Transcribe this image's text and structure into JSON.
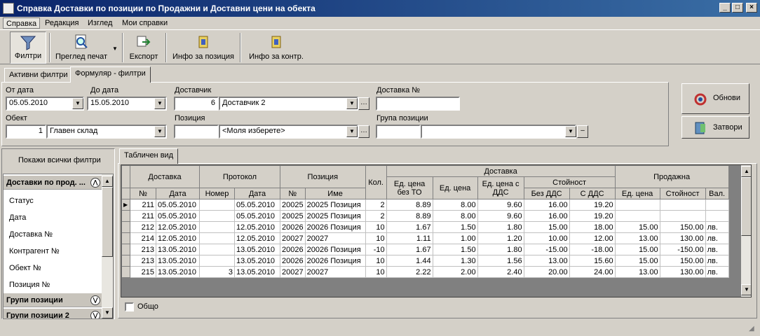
{
  "window": {
    "title": "Справка Доставки по позиции по Продажни и Доставни цени на обекта"
  },
  "menu": [
    "Справка",
    "Редакция",
    "Изглед",
    "Мои справки"
  ],
  "toolbar": {
    "filters": "Филтри",
    "print_preview": "Преглед печат",
    "export": "Експорт",
    "item_info": "Инфо за позиция",
    "contr_info": "Инфо за контр."
  },
  "filter_tabs": [
    "Активни филтри",
    "Формуляр - филтри"
  ],
  "form": {
    "from_date_label": "От дата",
    "from_date": "05.05.2010",
    "to_date_label": "До дата",
    "to_date": "15.05.2010",
    "supplier_label": "Доставчик",
    "supplier_id": "6",
    "supplier_name": "Доставчик 2",
    "delivery_no_label": "Доставка №",
    "delivery_no": "",
    "object_label": "Обект",
    "object_id": "1",
    "object_name": "Главен склад",
    "item_label": "Позиция",
    "item_id": "",
    "item_name": "<Моля изберете>",
    "item_group_label": "Група позиции",
    "item_group_id": "",
    "item_group_name": ""
  },
  "buttons": {
    "refresh": "Обнови",
    "close": "Затвори"
  },
  "left_panel": {
    "show_all": "Покажи всички филтри",
    "group1": "Доставки по прод. ...",
    "items": [
      "Статус",
      "Дата",
      "Доставка №",
      "Контрагент №",
      "Обект №",
      "Позиция №"
    ],
    "group2": "Групи позиции",
    "group3": "Групи позиции 2"
  },
  "grid_tab": "Табличен вид",
  "grid": {
    "h_delivery": "Доставка",
    "h_protocol": "Протокол",
    "h_item": "Позиция",
    "h_qty": "Кол.",
    "h_delivery2": "Доставка",
    "h_sale": "Продажна",
    "h_unit_price_no_to": "Ед. цена без ТО",
    "h_unit_price": "Ед. цена",
    "h_unit_price_vat": "Ед. цена с ДДС",
    "h_value": "Стойност",
    "h_no": "№",
    "h_date": "Дата",
    "h_number": "Номер",
    "h_pdate": "Дата",
    "h_ino": "№",
    "h_name": "Име",
    "h_no_vat": "Без ДДС",
    "h_with_vat": "С ДДС",
    "h_sale_price": "Ед. цена",
    "h_sale_value": "Стойност",
    "h_currency": "Вал.",
    "rows": [
      [
        "211",
        "05.05.2010",
        "",
        "05.05.2010",
        "20025",
        "20025 Позиция",
        "2",
        "8.89",
        "8.00",
        "9.60",
        "16.00",
        "19.20",
        "",
        "",
        ""
      ],
      [
        "211",
        "05.05.2010",
        "",
        "05.05.2010",
        "20025",
        "20025 Позиция",
        "2",
        "8.89",
        "8.00",
        "9.60",
        "16.00",
        "19.20",
        "",
        "",
        ""
      ],
      [
        "212",
        "12.05.2010",
        "",
        "12.05.2010",
        "20026",
        "20026 Позиция",
        "10",
        "1.67",
        "1.50",
        "1.80",
        "15.00",
        "18.00",
        "15.00",
        "150.00",
        "лв."
      ],
      [
        "214",
        "12.05.2010",
        "",
        "12.05.2010",
        "20027",
        "20027",
        "10",
        "1.11",
        "1.00",
        "1.20",
        "10.00",
        "12.00",
        "13.00",
        "130.00",
        "лв."
      ],
      [
        "213",
        "13.05.2010",
        "",
        "13.05.2010",
        "20026",
        "20026 Позиция",
        "-10",
        "1.67",
        "1.50",
        "1.80",
        "-15.00",
        "-18.00",
        "15.00",
        "-150.00",
        "лв."
      ],
      [
        "213",
        "13.05.2010",
        "",
        "13.05.2010",
        "20026",
        "20026 Позиция",
        "10",
        "1.44",
        "1.30",
        "1.56",
        "13.00",
        "15.60",
        "15.00",
        "150.00",
        "лв."
      ],
      [
        "215",
        "13.05.2010",
        "3",
        "13.05.2010",
        "20027",
        "20027",
        "10",
        "2.22",
        "2.00",
        "2.40",
        "20.00",
        "24.00",
        "13.00",
        "130.00",
        "лв."
      ]
    ]
  },
  "total_label": "Общо"
}
